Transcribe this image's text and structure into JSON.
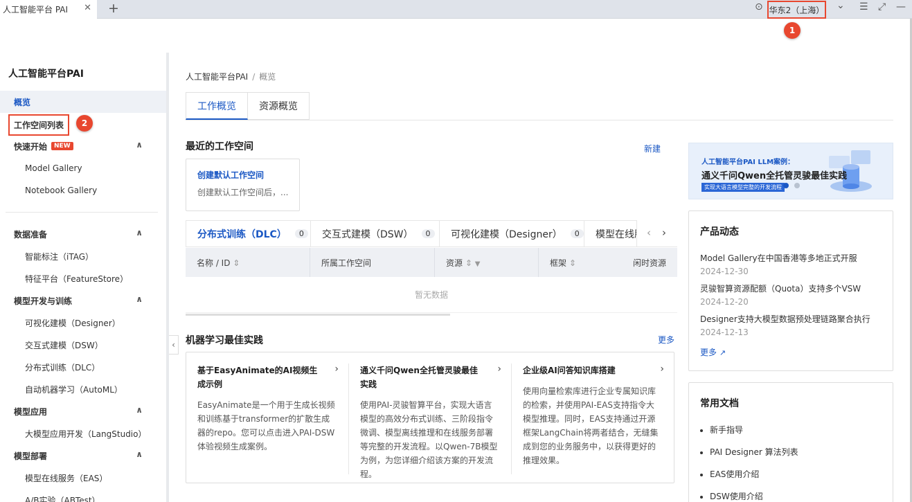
{
  "browser": {
    "tab_title": "人工智能平台 PAI",
    "close": "✕",
    "new_tab": "+",
    "region": "华东2（上海）",
    "location_icon": "⊙",
    "chevron": "⌄",
    "menu": "☰",
    "expand": "⤢",
    "minimize": "—"
  },
  "badges": {
    "b1": "1",
    "b2": "2"
  },
  "sidebar": {
    "title": "人工智能平台PAI",
    "overview": "概览",
    "workspace_list": "工作空间列表",
    "quickstart": {
      "label": "快速开始",
      "new": "NEW",
      "items": [
        "Model Gallery",
        "Notebook Gallery"
      ]
    },
    "data_prep": {
      "label": "数据准备",
      "items": [
        "智能标注（iTAG）",
        "特征平台（FeatureStore）"
      ]
    },
    "model_dev": {
      "label": "模型开发与训练",
      "items": [
        "可视化建模（Designer）",
        "交互式建模（DSW）",
        "分布式训练（DLC）",
        "自动机器学习（AutoML）"
      ]
    },
    "model_app": {
      "label": "模型应用",
      "items": [
        "大模型应用开发（LangStudio）"
      ]
    },
    "model_deploy": {
      "label": "模型部署",
      "items": [
        "模型在线服务（EAS）",
        "A/B实验（ABTest）"
      ]
    },
    "expand_icon": "∧",
    "collapse_icon": "‹"
  },
  "breadcrumb": {
    "root": "人工智能平台PAI",
    "sep": "/",
    "current": "概览"
  },
  "page_tabs": [
    "工作概览",
    "资源概览"
  ],
  "recent": {
    "title": "最近的工作空间",
    "new": "新建",
    "card_title": "创建默认工作空间",
    "card_desc": "创建默认工作空间后，..."
  },
  "job_tabs": [
    {
      "label": "分布式训练（DLC）",
      "count": "0"
    },
    {
      "label": "交互式建模（DSW）",
      "count": "0"
    },
    {
      "label": "可视化建模（Designer）",
      "count": "0"
    },
    {
      "label": "模型在线服"
    }
  ],
  "tab_arrows": {
    "left": "‹",
    "right": "›"
  },
  "table": {
    "columns": [
      "名称 / ID",
      "所属工作空间",
      "资源",
      "框架",
      "闲时资源"
    ],
    "sort": "⇕",
    "filter": "▼",
    "empty": "暂无数据"
  },
  "ml": {
    "title": "机器学习最佳实践",
    "more": "更多",
    "arrow": "›",
    "items": [
      {
        "title": "基于EasyAnimate的AI视频生成示例",
        "desc": "EasyAnimate是一个用于生成长视频和训练基于transformer的扩散生成器的repo。您可以点击进入PAI-DSW体验视频生成案例。"
      },
      {
        "title": "通义千问Qwen全托管灵骏最佳实践",
        "desc": "使用PAI-灵骏智算平台，实现大语言模型的高效分布式训练、三阶段指令微调、模型离线推理和在线服务部署等完整的开发流程。以Qwen-7B模型为例，为您详细介绍该方案的开发流程。"
      },
      {
        "title": "企业级AI问答知识库搭建",
        "desc": "使用向量检索库进行企业专属知识库的检索，并使用PAI-EAS支持指令大模型推理。同时，EAS支持通过开源框架LangChain将两者结合，无缝集成到您的业务服务中，以获得更好的推理效果。"
      }
    ]
  },
  "banner": {
    "line1": "人工智能平台PAI LLM案例：",
    "line2": "通义千问Qwen全托管灵骏最佳实践",
    "line3": "实现大语言模型完整的开发流程"
  },
  "product_news": {
    "title": "产品动态",
    "items": [
      {
        "text": "Model Gallery在中国香港等多地正式开服",
        "date": "2024-12-30"
      },
      {
        "text": "灵骏智算资源配额（Quota）支持多个VSW",
        "date": "2024-12-20"
      },
      {
        "text": "Designer支持大模型数据预处理链路聚合执行",
        "date": "2024-12-13"
      }
    ],
    "more": "更多",
    "external_icon": "↗"
  },
  "docs": {
    "title": "常用文档",
    "items": [
      "新手指导",
      "PAI Designer 算法列表",
      "EAS使用介绍",
      "DSW使用介绍"
    ]
  },
  "colors": {
    "accent": "#1b58c4",
    "highlight": "#e8472f"
  }
}
